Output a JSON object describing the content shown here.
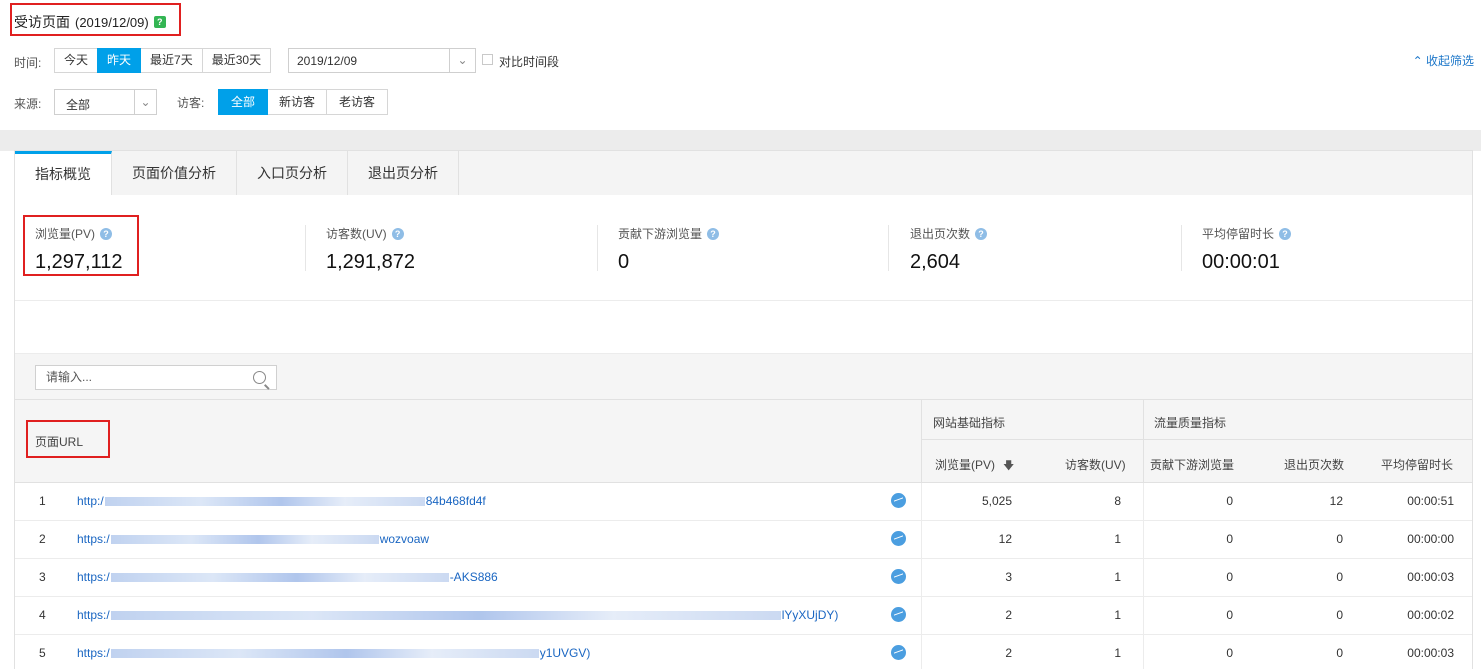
{
  "header": {
    "title": "受访页面",
    "date": "(2019/12/09)",
    "help": "?"
  },
  "time_filter": {
    "label": "时间:",
    "options": [
      "今天",
      "昨天",
      "最近7天",
      "最近30天"
    ],
    "selected": "昨天",
    "date_value": "2019/12/09",
    "compare_label": "对比时间段",
    "collapse_label": "收起筛选"
  },
  "source_filter": {
    "label": "来源:",
    "value": "全部"
  },
  "visitor_filter": {
    "label": "访客:",
    "options": [
      "全部",
      "新访客",
      "老访客"
    ],
    "selected": "全部"
  },
  "tabs": [
    "指标概览",
    "页面价值分析",
    "入口页分析",
    "退出页分析"
  ],
  "active_tab": "指标概览",
  "metrics": [
    {
      "label": "浏览量(PV)",
      "value": "1,297,112"
    },
    {
      "label": "访客数(UV)",
      "value": "1,291,872"
    },
    {
      "label": "贡献下游浏览量",
      "value": "0"
    },
    {
      "label": "退出页次数",
      "value": "2,604"
    },
    {
      "label": "平均停留时长",
      "value": "00:00:01"
    }
  ],
  "search": {
    "placeholder": "请输入..."
  },
  "table": {
    "url_header": "页面URL",
    "group_basic": "网站基础指标",
    "group_quality": "流量质量指标",
    "columns": [
      "浏览量(PV)",
      "访客数(UV)",
      "贡献下游浏览量",
      "退出页次数",
      "平均停留时长"
    ],
    "rows": [
      {
        "idx": "1",
        "url_start": "http:/",
        "url_end": "84b468fd4f",
        "pv": "5,025",
        "uv": "8",
        "down": "0",
        "exits": "12",
        "avg": "00:00:51"
      },
      {
        "idx": "2",
        "url_start": "https:/",
        "url_end": "wozvoaw",
        "pv": "12",
        "uv": "1",
        "down": "0",
        "exits": "0",
        "avg": "00:00:00"
      },
      {
        "idx": "3",
        "url_start": "https:/",
        "url_end": "-AKS886",
        "pv": "3",
        "uv": "1",
        "down": "0",
        "exits": "0",
        "avg": "00:00:03"
      },
      {
        "idx": "4",
        "url_start": "https:/",
        "url_end": "lYyXUjDY)",
        "pv": "2",
        "uv": "1",
        "down": "0",
        "exits": "0",
        "avg": "00:00:02"
      },
      {
        "idx": "5",
        "url_start": "https:/",
        "url_end": "y1UVGV)",
        "pv": "2",
        "uv": "1",
        "down": "0",
        "exits": "0",
        "avg": "00:00:03"
      }
    ]
  },
  "colors": {
    "accent": "#00a0e9",
    "link": "#1a66c2",
    "highlight": "#e02020"
  }
}
